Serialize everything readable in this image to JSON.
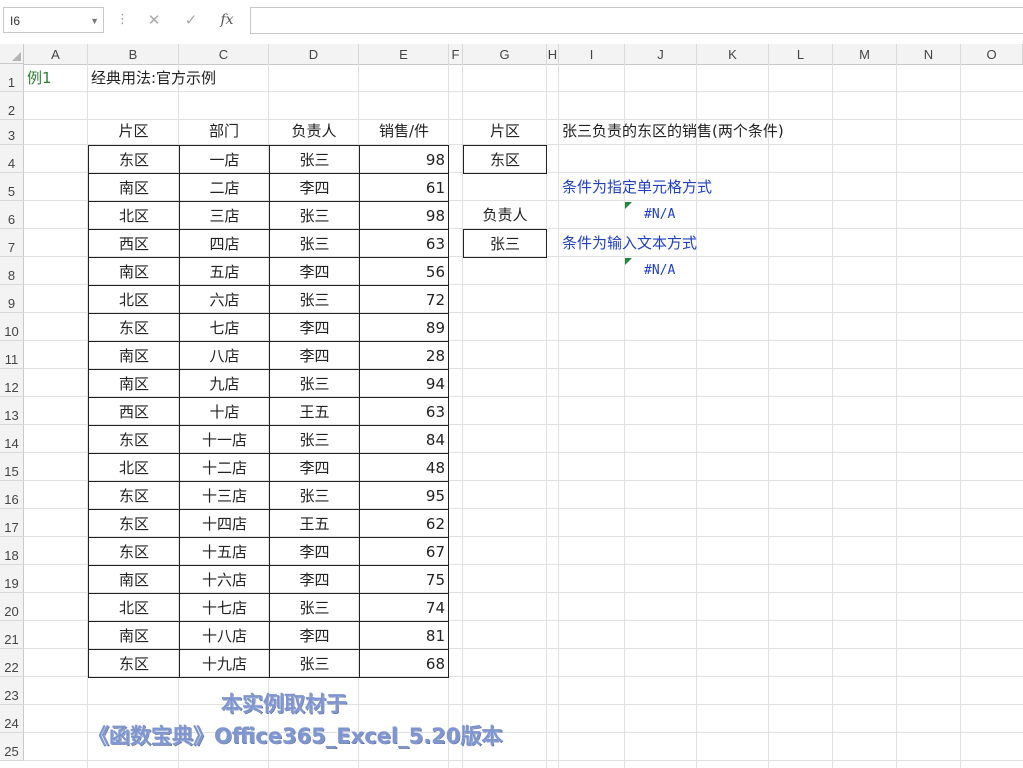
{
  "formula_bar": {
    "name_box": "I6",
    "cancel_icon": "close-icon",
    "enter_icon": "check-icon",
    "fx_label": "fx",
    "formula": ""
  },
  "columns": [
    "A",
    "B",
    "C",
    "D",
    "E",
    "F",
    "G",
    "H",
    "I",
    "J",
    "K",
    "L",
    "M",
    "N",
    "O"
  ],
  "rows": [
    "1",
    "2",
    "3",
    "4",
    "5",
    "6",
    "7",
    "8",
    "9",
    "10",
    "11",
    "12",
    "13",
    "14",
    "15",
    "16",
    "17",
    "18",
    "19",
    "20",
    "21",
    "22",
    "23",
    "24",
    "25"
  ],
  "title": {
    "label": "例1",
    "subtitle": "经典用法:官方示例"
  },
  "table": {
    "headers": [
      "片区",
      "部门",
      "负责人",
      "销售/件"
    ],
    "rows": [
      [
        "东区",
        "一店",
        "张三",
        "98"
      ],
      [
        "南区",
        "二店",
        "李四",
        "61"
      ],
      [
        "北区",
        "三店",
        "张三",
        "98"
      ],
      [
        "西区",
        "四店",
        "张三",
        "63"
      ],
      [
        "南区",
        "五店",
        "李四",
        "56"
      ],
      [
        "北区",
        "六店",
        "张三",
        "72"
      ],
      [
        "东区",
        "七店",
        "李四",
        "89"
      ],
      [
        "南区",
        "八店",
        "李四",
        "28"
      ],
      [
        "南区",
        "九店",
        "张三",
        "94"
      ],
      [
        "西区",
        "十店",
        "王五",
        "63"
      ],
      [
        "东区",
        "十一店",
        "张三",
        "84"
      ],
      [
        "北区",
        "十二店",
        "李四",
        "48"
      ],
      [
        "东区",
        "十三店",
        "张三",
        "95"
      ],
      [
        "东区",
        "十四店",
        "王五",
        "62"
      ],
      [
        "东区",
        "十五店",
        "李四",
        "67"
      ],
      [
        "南区",
        "十六店",
        "李四",
        "75"
      ],
      [
        "北区",
        "十七店",
        "张三",
        "74"
      ],
      [
        "南区",
        "十八店",
        "李四",
        "81"
      ],
      [
        "东区",
        "十九店",
        "张三",
        "68"
      ]
    ]
  },
  "criteria": {
    "region_header": "片区",
    "region_value": "东区",
    "person_header": "负责人",
    "person_value": "张三"
  },
  "notes": {
    "question": "张三负责的东区的销售(两个条件)",
    "method1": "条件为指定单元格方式",
    "result1": "#N/A",
    "method2": "条件为输入文本方式",
    "result2": "#N/A"
  },
  "watermark": {
    "line1": "本实例取材于",
    "line2": "《函数宝典》Office365_Excel_5.20版本"
  },
  "colors": {
    "blue_text": "#1f3fbf",
    "green_text": "#2e7d32",
    "error_flag": "#1e8a3c"
  }
}
